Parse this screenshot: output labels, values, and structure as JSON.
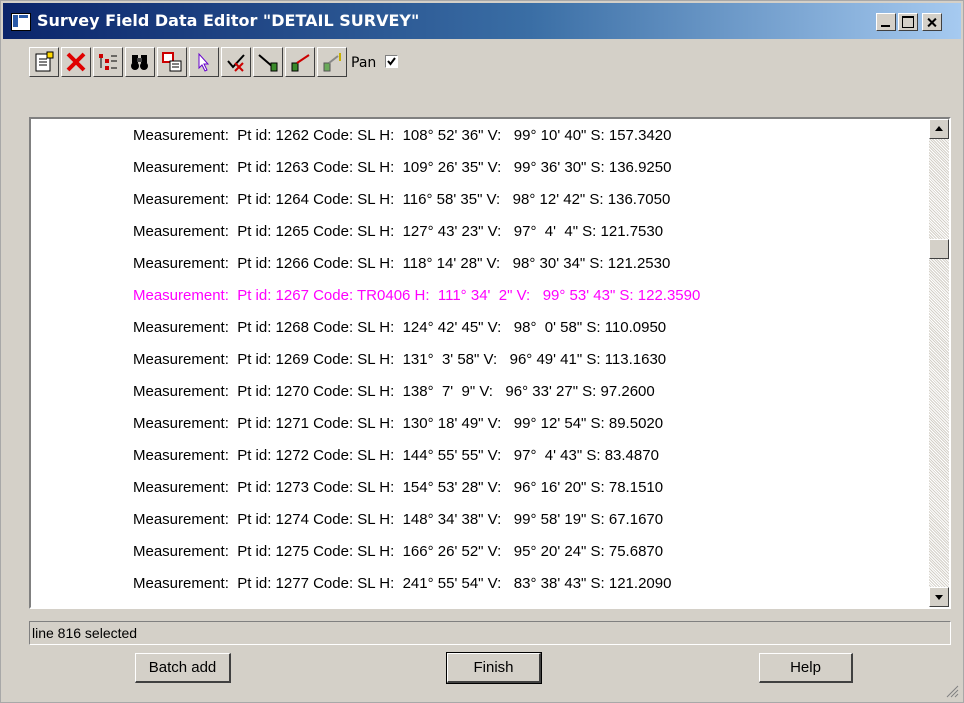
{
  "window": {
    "title": "Survey Field Data Editor \"DETAIL SURVEY\"",
    "controls": {
      "minimize": "minimize",
      "maximize": "maximize",
      "close": "close"
    }
  },
  "toolbar": {
    "buttons": [
      {
        "name": "insert-icon"
      },
      {
        "name": "delete-icon"
      },
      {
        "name": "tree-icon"
      },
      {
        "name": "binoculars-icon"
      },
      {
        "name": "copy-icon"
      },
      {
        "name": "select-arrow-icon"
      },
      {
        "name": "edit-check-icon"
      },
      {
        "name": "setup-icon"
      },
      {
        "name": "measure-icon"
      },
      {
        "name": "target-icon"
      }
    ],
    "pan_label": "Pan",
    "pan_checked": true
  },
  "list": {
    "rows": [
      {
        "text": "Measurement:  Pt id: 1262 Code: SL H:  108° 52' 36\" V:   99° 10' 40\" S: 157.3420",
        "highlight": false
      },
      {
        "text": "Measurement:  Pt id: 1263 Code: SL H:  109° 26' 35\" V:   99° 36' 30\" S: 136.9250",
        "highlight": false
      },
      {
        "text": "Measurement:  Pt id: 1264 Code: SL H:  116° 58' 35\" V:   98° 12' 42\" S: 136.7050",
        "highlight": false
      },
      {
        "text": "Measurement:  Pt id: 1265 Code: SL H:  127° 43' 23\" V:   97°  4'  4\" S: 121.7530",
        "highlight": false
      },
      {
        "text": "Measurement:  Pt id: 1266 Code: SL H:  118° 14' 28\" V:   98° 30' 34\" S: 121.2530",
        "highlight": false
      },
      {
        "text": "Measurement:  Pt id: 1267 Code: TR0406 H:  111° 34'  2\" V:   99° 53' 43\" S: 122.3590",
        "highlight": true
      },
      {
        "text": "Measurement:  Pt id: 1268 Code: SL H:  124° 42' 45\" V:   98°  0' 58\" S: 110.0950",
        "highlight": false
      },
      {
        "text": "Measurement:  Pt id: 1269 Code: SL H:  131°  3' 58\" V:   96° 49' 41\" S: 113.1630",
        "highlight": false
      },
      {
        "text": "Measurement:  Pt id: 1270 Code: SL H:  138°  7'  9\" V:   96° 33' 27\" S: 97.2600",
        "highlight": false
      },
      {
        "text": "Measurement:  Pt id: 1271 Code: SL H:  130° 18' 49\" V:   99° 12' 54\" S: 89.5020",
        "highlight": false
      },
      {
        "text": "Measurement:  Pt id: 1272 Code: SL H:  144° 55' 55\" V:   97°  4' 43\" S: 83.4870",
        "highlight": false
      },
      {
        "text": "Measurement:  Pt id: 1273 Code: SL H:  154° 53' 28\" V:   96° 16' 20\" S: 78.1510",
        "highlight": false
      },
      {
        "text": "Measurement:  Pt id: 1274 Code: SL H:  148° 34' 38\" V:   99° 58' 19\" S: 67.1670",
        "highlight": false
      },
      {
        "text": "Measurement:  Pt id: 1275 Code: SL H:  166° 26' 52\" V:   95° 20' 24\" S: 75.6870",
        "highlight": false
      },
      {
        "text": "Measurement:  Pt id: 1277 Code: SL H:  241° 55' 54\" V:   83° 38' 43\" S: 121.2090",
        "highlight": false
      }
    ],
    "highlight_color": "#ff00ff"
  },
  "status": {
    "text": "line 816 selected"
  },
  "buttons": {
    "batch_add": "Batch add",
    "finish": "Finish",
    "help": "Help"
  }
}
